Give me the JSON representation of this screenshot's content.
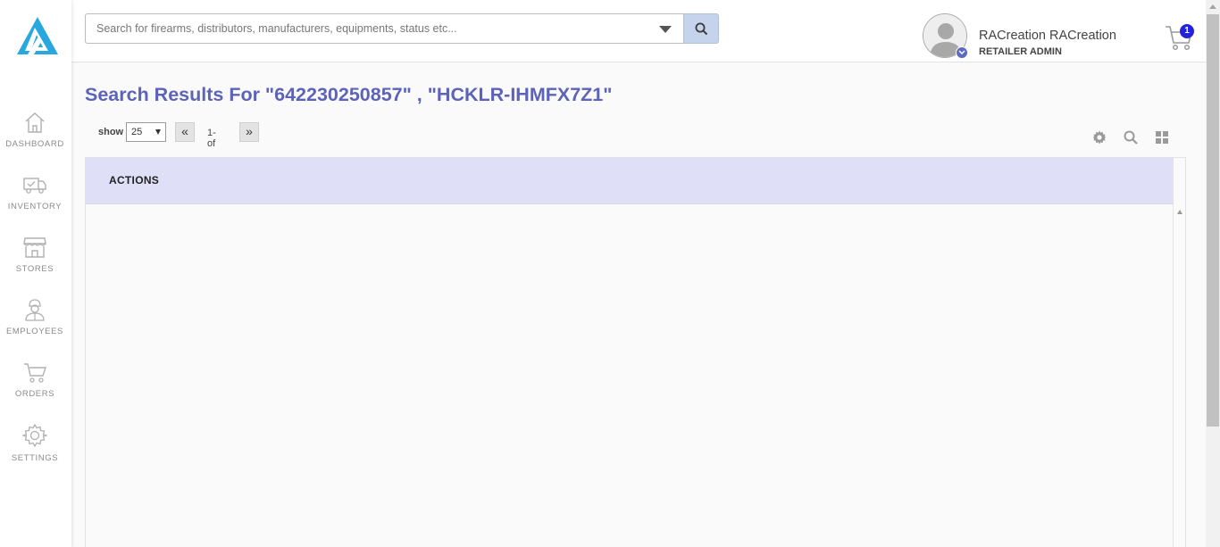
{
  "sidebar": {
    "items": [
      {
        "label": "DASHBOARD",
        "icon": "home-icon"
      },
      {
        "label": "INVENTORY",
        "icon": "truck-icon"
      },
      {
        "label": "STORES",
        "icon": "store-icon"
      },
      {
        "label": "EMPLOYEES",
        "icon": "employee-icon"
      },
      {
        "label": "ORDERS",
        "icon": "cart-icon"
      },
      {
        "label": "SETTINGS",
        "icon": "gear-icon"
      }
    ]
  },
  "header": {
    "search_placeholder": "Search for firearms, distributors, manufacturers, equipments, status etc...",
    "user_name": "RACreation RACreation",
    "user_role": "RETAILER ADMIN",
    "cart_count": "1"
  },
  "main": {
    "title": "Search Results For \"642230250857\" , \"HCKLR-IHMFX7Z1\"",
    "show_label": "show",
    "page_size": "25",
    "prev_label": "«",
    "next_label": "»",
    "page_info": "1- of",
    "table_columns": [
      "ACTIONS"
    ]
  },
  "colors": {
    "accent": "#5c63b8",
    "table_header_bg": "#dfe0f8",
    "search_button_bg": "#c5d4ec",
    "logo": "#29a8e0",
    "cart_badge": "#2222dd"
  }
}
